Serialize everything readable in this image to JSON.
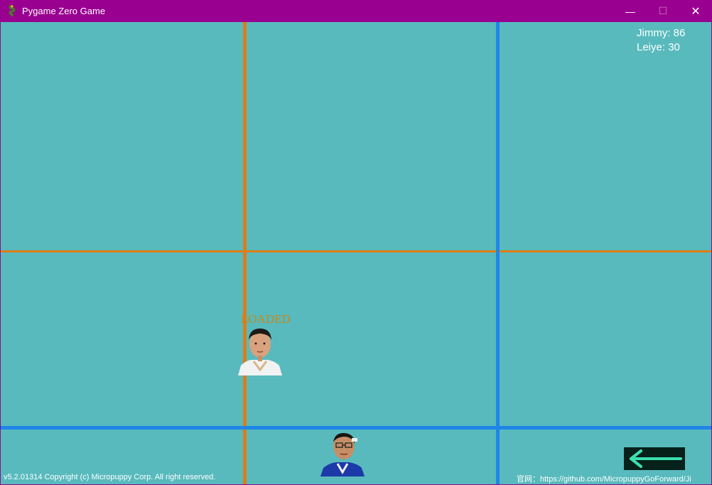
{
  "window": {
    "title": "Pygame Zero Game",
    "minimize_glyph": "—",
    "maximize_glyph": "☐",
    "close_glyph": "✕"
  },
  "scores": [
    {
      "text": "Jimmy: 86"
    },
    {
      "text": "Leiye: 30"
    }
  ],
  "players": [
    {
      "status": "LOADED",
      "color": "#c9871a"
    },
    {
      "status": "",
      "color": "#16c8c8"
    }
  ],
  "grid_colors": {
    "player1": "#df7c16",
    "player2": "#1e86e8",
    "background": "#58babd"
  },
  "back_button": {
    "icon": "arrow-left-icon",
    "color": "#3de0b0"
  },
  "footer": {
    "copyright": "v5.2.01314 Copyright (c) Micropuppy Corp. All right reserved.",
    "website": "官网：https://github.com/MicropuppyGoForward/Ji"
  }
}
